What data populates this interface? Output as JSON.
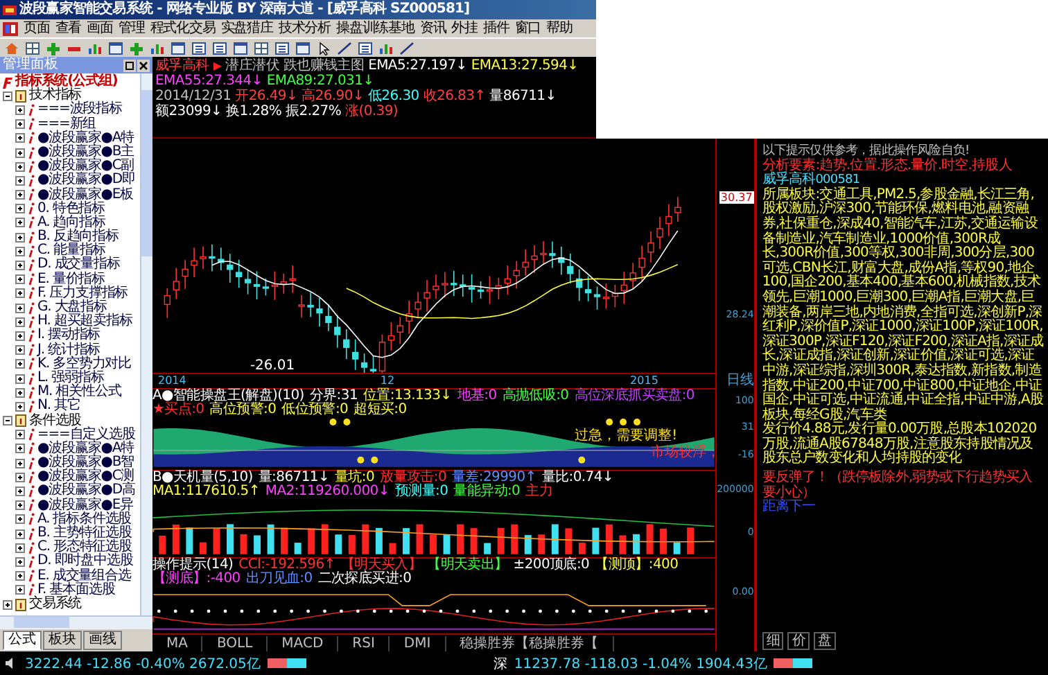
{
  "window": {
    "title": "波段赢家智能交易系统 - 网络专业版 BY 深南大道 - [威孚高科 SZ000581]"
  },
  "menu": [
    "页面",
    "查看",
    "画面",
    "管理",
    "程式化交易",
    "实盘猎庄",
    "技术分析",
    "操盘训练基地",
    "资讯",
    "外挂",
    "插件",
    "窗口",
    "帮助"
  ],
  "side_panel": {
    "title": "管理面板",
    "tree": [
      {
        "label": "指标系统(公式组)",
        "children": [
          {
            "label": "技术指标",
            "expanded": true,
            "children": [
              {
                "label": "===波段指标",
                "expanded": false
              },
              {
                "label": "===新组",
                "expanded": false
              },
              {
                "label": "●波段赢家●A特",
                "expanded": false
              },
              {
                "label": "●波段赢家●B主",
                "expanded": false
              },
              {
                "label": "●波段赢家●C副",
                "expanded": false
              },
              {
                "label": "●波段赢家●D即",
                "expanded": false
              },
              {
                "label": "●波段赢家●E板",
                "expanded": false
              },
              {
                "label": "0. 特色指标",
                "expanded": false
              },
              {
                "label": "A. 趋向指标",
                "expanded": false
              },
              {
                "label": "B. 反趋向指标",
                "expanded": false
              },
              {
                "label": "C. 能量指标",
                "expanded": false
              },
              {
                "label": "D. 成交量指标",
                "expanded": false
              },
              {
                "label": "E. 量价指标",
                "expanded": false
              },
              {
                "label": "F. 压力支撑指标",
                "expanded": false
              },
              {
                "label": "G. 大盘指标",
                "expanded": false
              },
              {
                "label": "H. 超买超卖指标",
                "expanded": false
              },
              {
                "label": "I. 摆动指标",
                "expanded": false
              },
              {
                "label": "J. 统计指标",
                "expanded": false
              },
              {
                "label": "K. 多空势力对比",
                "expanded": false
              },
              {
                "label": "L. 强弱指标",
                "expanded": false
              },
              {
                "label": "M. 相关性公式",
                "expanded": false
              },
              {
                "label": "N. 其它",
                "expanded": false
              }
            ]
          },
          {
            "label": "条件选股",
            "expanded": true,
            "children": [
              {
                "label": "===自定义选股",
                "expanded": false
              },
              {
                "label": "●波段赢家●A特",
                "expanded": false
              },
              {
                "label": "●波段赢家●B智",
                "expanded": false
              },
              {
                "label": "●波段赢家●C测",
                "expanded": false
              },
              {
                "label": "●波段赢家●D高",
                "expanded": false
              },
              {
                "label": "●波段赢家●E异",
                "expanded": false
              },
              {
                "label": "A. 指标条件选股",
                "expanded": false
              },
              {
                "label": "B. 主势特征选股",
                "expanded": false
              },
              {
                "label": "C. 形态特征选股",
                "expanded": false
              },
              {
                "label": "D. 即时盘中选股",
                "expanded": false
              },
              {
                "label": "E. 成交量组合选",
                "expanded": false
              },
              {
                "label": "F. 基本面选股",
                "expanded": false
              }
            ]
          },
          {
            "label": "交易系统",
            "expanded": false
          }
        ]
      }
    ],
    "tabs": [
      {
        "label": "公式",
        "selected": true
      },
      {
        "label": "板块",
        "selected": false
      },
      {
        "label": "画线",
        "selected": false
      }
    ]
  },
  "chart_header": {
    "stock": "威孚高科",
    "marker": "▶",
    "title": "潜庄潜伏 跌也赚钱主图",
    "indicators": [
      {
        "text": "EMA5:27.197↓",
        "color": "#ffffff"
      },
      {
        "text": "EMA13:27.594↓",
        "color": "#ffff40"
      },
      {
        "text": "EMA55:27.344↓",
        "color": "#ff40ff"
      },
      {
        "text": "EMA89:27.031↓",
        "color": "#40ff40"
      }
    ],
    "quote": [
      {
        "text": "2014/12/31",
        "color": "#c0c0c0"
      },
      {
        "text": "开26.49↓",
        "color": "#ff4040"
      },
      {
        "text": "高26.90↓",
        "color": "#ff4040"
      },
      {
        "text": "低26.30",
        "color": "#40ffff"
      },
      {
        "text": "收26.83↑",
        "color": "#ff4040"
      },
      {
        "text": "量86711↓",
        "color": "#ffffff"
      },
      {
        "text": "额23099↓",
        "color": "#ffffff"
      },
      {
        "text": "换1.28%",
        "color": "#ffffff"
      },
      {
        "text": "振2.27%",
        "color": "#ffffff"
      },
      {
        "text": "涨(0.39)",
        "color": "#ff4040"
      }
    ]
  },
  "price_chart": {
    "low_label": "-26.01",
    "dates": [
      "2014",
      "12",
      "2015"
    ]
  },
  "indicators": [
    {
      "kind": "band",
      "header": [
        {
          "text": "A●智能操盘王(解盘)(10)",
          "color": "#ffffff"
        },
        {
          "text": "分界:31",
          "color": "#ffffff"
        },
        {
          "text": "位置:13.133↓",
          "color": "#ffff40"
        },
        {
          "text": "地基:0",
          "color": "#ff40ff"
        },
        {
          "text": "高抛低吸:0",
          "color": "#40ff40"
        },
        {
          "text": "高位深底抓买卖盘:0",
          "color": "#c040ff"
        },
        {
          "text": "★买点:0",
          "color": "#ff3030"
        },
        {
          "text": "高位预警:0",
          "color": "#ffff40"
        },
        {
          "text": "低位预警:0",
          "color": "#ffff40"
        },
        {
          "text": "超短买:0",
          "color": "#ffff40"
        }
      ],
      "notes": [
        "过急，需要调整!",
        "市场较浮，"
      ]
    },
    {
      "kind": "volume",
      "header": [
        {
          "text": "B●天机量(5,10)",
          "color": "#ffffff"
        },
        {
          "text": "量:86711↓",
          "color": "#ffffff"
        },
        {
          "text": "量坑:0",
          "color": "#ffff40"
        },
        {
          "text": "放量攻击:0",
          "color": "#ff3030"
        },
        {
          "text": "量差:29990↑",
          "color": "#6090ff"
        },
        {
          "text": "量比:0.74↓",
          "color": "#ffffff"
        },
        {
          "text": "MA1:117610.5↑",
          "color": "#ffff40"
        },
        {
          "text": "MA2:119260.000↓",
          "color": "#ff40ff"
        },
        {
          "text": "预测量:0",
          "color": "#40ffff"
        },
        {
          "text": "量能异动:0",
          "color": "#40ff40"
        },
        {
          "text": "主力",
          "color": "#ff3030"
        }
      ]
    },
    {
      "kind": "lines",
      "header": [
        {
          "text": "操作提示(14)",
          "color": "#ffffff"
        },
        {
          "text": "CCI:-192.596↑",
          "color": "#ff3030"
        },
        {
          "text": "【明天买入】",
          "color": "#ff3030"
        },
        {
          "text": "【明天卖出】",
          "color": "#40ff40"
        },
        {
          "text": "±200顶底:0",
          "color": "#ffffff"
        },
        {
          "text": "【测顶】:400",
          "color": "#ffff40"
        },
        {
          "text": "【测底】:-400",
          "color": "#ff40ff"
        },
        {
          "text": "出刀见血:0",
          "color": "#6090ff"
        },
        {
          "text": "二次探底买进:0",
          "color": "#ffffff"
        }
      ]
    }
  ],
  "bottom_tabs": [
    {
      "label": "MA",
      "selected": false
    },
    {
      "label": "BOLL",
      "selected": false
    },
    {
      "label": "MACD",
      "selected": false
    },
    {
      "label": "RSI",
      "selected": false
    },
    {
      "label": "DMI",
      "selected": false
    },
    {
      "label": "稳操胜券【稳操胜券【",
      "selected": false
    }
  ],
  "axis": {
    "price": [
      "30.37",
      "28.24"
    ],
    "period": "日线",
    "a": [
      "100",
      "31",
      "-16"
    ],
    "b": [
      "200000",
      "0"
    ],
    "c": [
      "0.00"
    ]
  },
  "info": {
    "notice": "以下提示仅供参考，据此操作风险自负!",
    "factors": "分析要素:趋势.位置.形态.量价.时空.持股人",
    "stock_name": "威孚高科",
    "stock_code": "000581",
    "sectors": "所属板块:交通工具,PM2.5,参股金融,长江三角,股权激励,沪深300,节能环保,燃料电池,融资融券,社保重仓,深成40,智能汽车,江苏,交通运输设备制造业,汽车制造业,1000价值,300R成长,300R价值,300等权,300非周,300分层,300可选,CBN长江,财富大盘,成份A指,等权90,地企100,国企200,基本400,基本600,机械指数,技术领先,巨潮1000,巨潮300,巨潮A指,巨潮大盘,巨潮装备,两岸三地,内地消费,全指可选,深创新P,深红利P,深价值P,深证1000,深证100P,深证100R,深证300P,深证F120,深证F200,深证A指,深证成长,深证成指,深证创新,深证价值,深证可选,深证中游,深证综指,深圳300R,泰达指数,新指数,制造指数,中证200,中证700,中证800,中证地企,中证国企,中证可选,中证流通,中证全指,中证中游,A股板块,每经G股,汽车类",
    "issue": "发行价4.88元,发行量0.00万股,总股本102020万股,流通A股67848万股,注意股东持股情况及股东总户数变化和人均持股的变化",
    "signal": "要反弹了！（跌停板除外,弱势或下行趋势买入要小心）",
    "distance": "距离下一",
    "tabs": [
      {
        "label": "细",
        "selected": false
      },
      {
        "label": "价",
        "selected": false
      },
      {
        "label": "盘",
        "selected": false
      }
    ]
  },
  "status_bar": {
    "sh": "3222.44 -12.86 -0.40% 2672.05亿",
    "sz_label": "深",
    "sz": "11237.78 -118.03 -1.04% 1904.43亿"
  }
}
